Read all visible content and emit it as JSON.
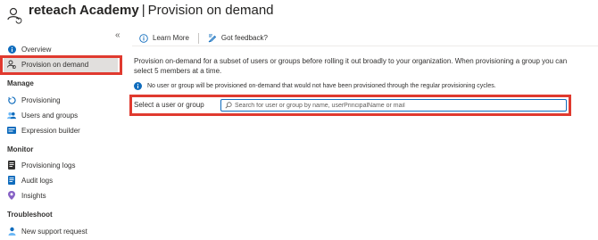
{
  "header": {
    "org": "reteach Academy",
    "separator": "|",
    "title": "Provision on demand",
    "more": "···"
  },
  "sidebar": {
    "collapse": "«",
    "items_top": [
      {
        "label": "Overview",
        "icon": "info-icon"
      },
      {
        "label": "Provision on demand",
        "icon": "user-sync-icon"
      }
    ],
    "manage_heading": "Manage",
    "manage_items": [
      {
        "label": "Provisioning",
        "icon": "provisioning-icon"
      },
      {
        "label": "Users and groups",
        "icon": "users-groups-icon"
      },
      {
        "label": "Expression builder",
        "icon": "expression-builder-icon"
      }
    ],
    "monitor_heading": "Monitor",
    "monitor_items": [
      {
        "label": "Provisioning logs",
        "icon": "provisioning-logs-icon"
      },
      {
        "label": "Audit logs",
        "icon": "audit-logs-icon"
      },
      {
        "label": "Insights",
        "icon": "insights-icon"
      }
    ],
    "troubleshoot_heading": "Troubleshoot",
    "troubleshoot_items": [
      {
        "label": "New support request",
        "icon": "support-request-icon"
      }
    ]
  },
  "toolbar": {
    "learn_more": "Learn More",
    "feedback": "Got feedback?"
  },
  "main": {
    "description": "Provision on-demand for a subset of users or groups before rolling it out broadly to your organization. When provisioning a group you can select 5 members at a time.",
    "info": "No user or group will be provisioned on-demand that would not have been provisioned through the regular provisioning cycles.",
    "field_label": "Select a user or group",
    "search_placeholder": "Search for user or group by name, userPrincipalName or mail",
    "search_value": ""
  },
  "colors": {
    "accent": "#0f6cbd",
    "highlight": "#e03a2f",
    "selected_bg": "#e1dfdd"
  }
}
